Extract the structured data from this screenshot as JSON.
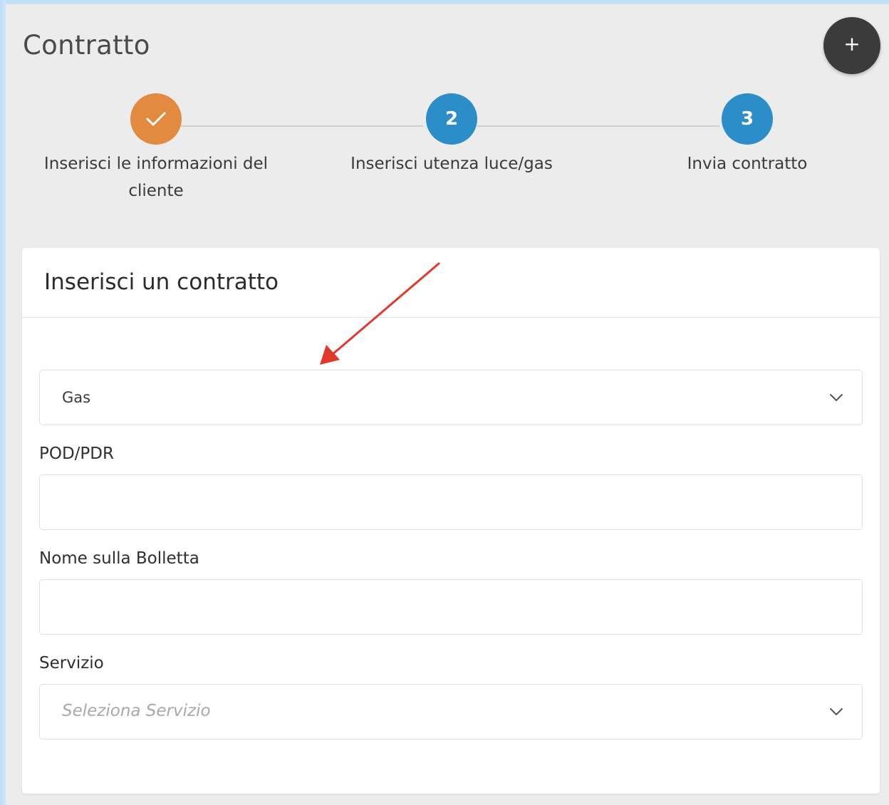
{
  "page": {
    "title": "Contratto",
    "add_button_label": "+"
  },
  "stepper": {
    "steps": [
      {
        "number": "",
        "label": "Inserisci le informazioni del cliente",
        "status": "completed",
        "color": "#e28a3f"
      },
      {
        "number": "2",
        "label": "Inserisci utenza luce/gas",
        "status": "active",
        "color": "#2d8dc9"
      },
      {
        "number": "3",
        "label": "Invia contratto",
        "status": "pending",
        "color": "#2d8dc9"
      }
    ]
  },
  "card": {
    "title": "Inserisci un contratto",
    "utility_select": {
      "value": "Gas",
      "icon": "chevron-down-icon"
    },
    "pod_pdr": {
      "label": "POD/PDR",
      "value": ""
    },
    "nome_bolletta": {
      "label": "Nome sulla Bolletta",
      "value": ""
    },
    "servizio": {
      "label": "Servizio",
      "placeholder": "Seleziona Servizio",
      "icon": "chevron-down-icon"
    }
  },
  "annotation": {
    "color": "#e0392b",
    "icon": "red-arrow-annotation"
  }
}
